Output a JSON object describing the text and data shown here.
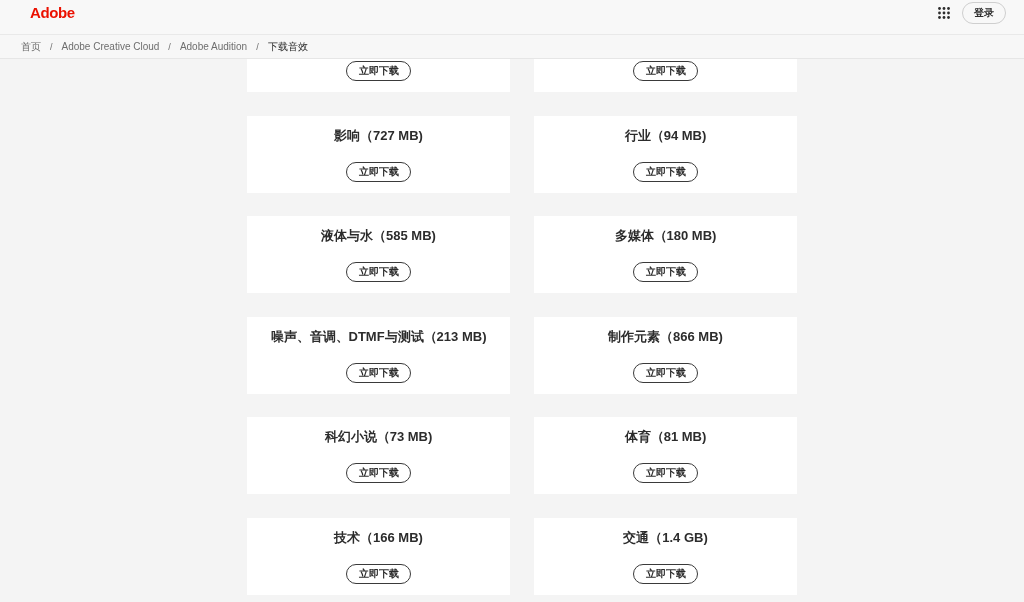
{
  "header": {
    "logo": "Adobe",
    "sign_in": "登录"
  },
  "breadcrumb": [
    {
      "kind": "link",
      "label": "首页",
      "current": false
    },
    {
      "kind": "separator",
      "label": "/"
    },
    {
      "kind": "link",
      "label": "Adobe Creative Cloud",
      "current": false
    },
    {
      "kind": "separator",
      "label": "/"
    },
    {
      "kind": "link",
      "label": "Adobe Audition",
      "current": false
    },
    {
      "kind": "separator",
      "label": "/"
    },
    {
      "kind": "link",
      "label": "下载音效",
      "current": true
    }
  ],
  "downloads": [
    {
      "button": "立即下载"
    },
    {
      "button": "立即下载"
    },
    {
      "title": "影响（727 MB)",
      "button": "立即下载"
    },
    {
      "title": "行业（94 MB)",
      "button": "立即下载"
    },
    {
      "title": "液体与水（585 MB)",
      "button": "立即下载"
    },
    {
      "title": "多媒体（180 MB)",
      "button": "立即下载"
    },
    {
      "title": "噪声、音调、DTMF与测试（213 MB)",
      "button": "立即下载"
    },
    {
      "title": "制作元素（866 MB)",
      "button": "立即下载"
    },
    {
      "title": "科幻小说（73 MB)",
      "button": "立即下载"
    },
    {
      "title": "体育（81 MB)",
      "button": "立即下载"
    },
    {
      "title": "技术（166 MB)",
      "button": "立即下载"
    },
    {
      "title": "交通（1.4 GB)",
      "button": "立即下载"
    }
  ]
}
